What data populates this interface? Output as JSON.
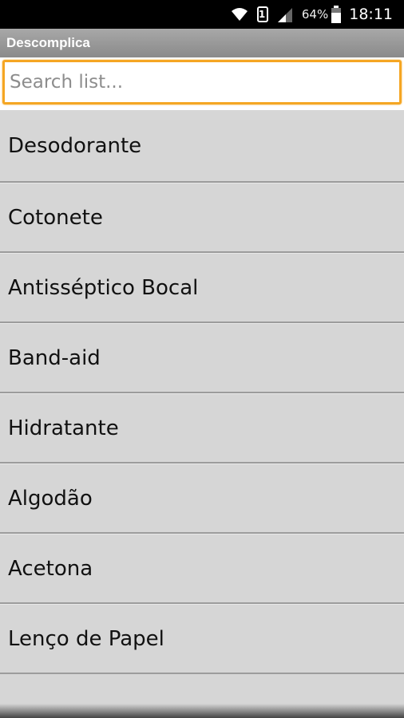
{
  "status_bar": {
    "sim_label": "1",
    "battery_percent": "64%",
    "time": "18:11"
  },
  "app": {
    "title": "Descomplica"
  },
  "search": {
    "placeholder": "Search list..."
  },
  "list": {
    "items": [
      {
        "label": "Desodorante"
      },
      {
        "label": "Cotonete"
      },
      {
        "label": "Antisséptico Bocal"
      },
      {
        "label": "Band-aid"
      },
      {
        "label": "Hidratante"
      },
      {
        "label": "Algodão"
      },
      {
        "label": "Acetona"
      },
      {
        "label": "Lenço de Papel"
      }
    ]
  }
}
